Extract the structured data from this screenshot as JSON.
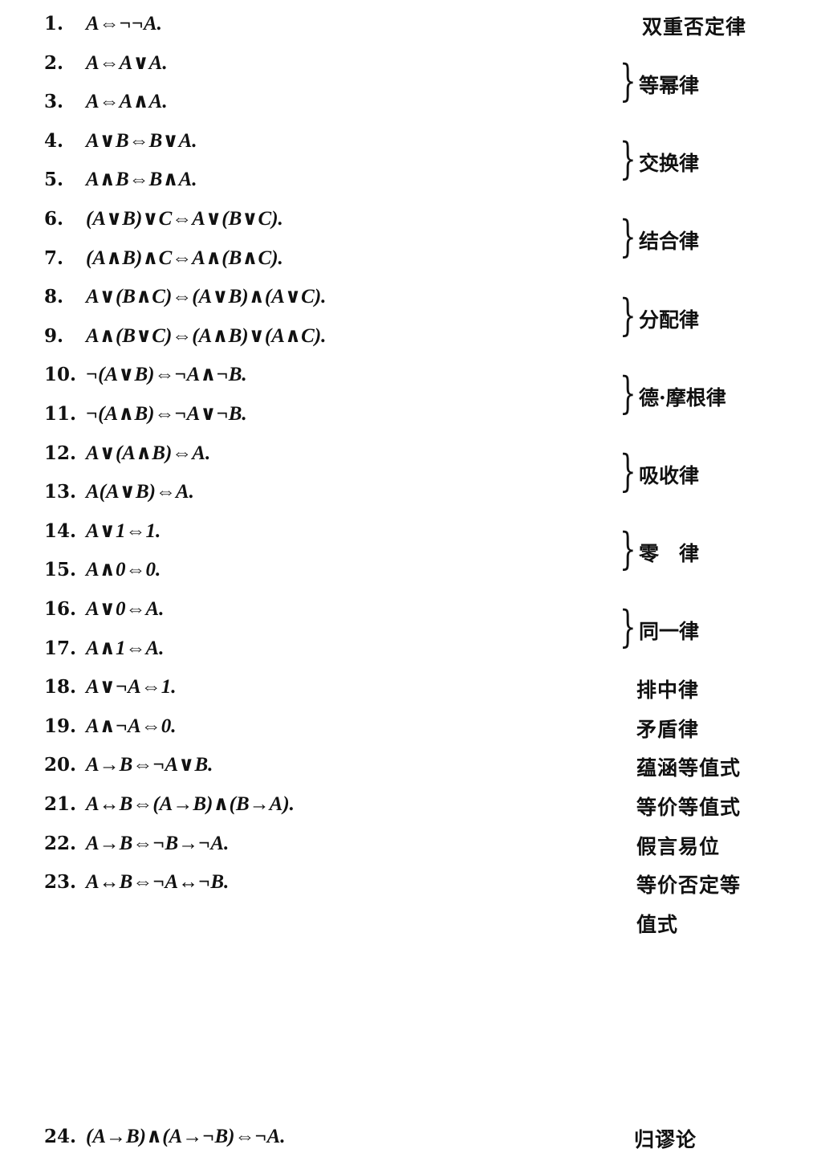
{
  "formulas": [
    {
      "n": "1.",
      "f": "A⇔¬¬A."
    },
    {
      "n": "2.",
      "f": "A⇔A∨A."
    },
    {
      "n": "3.",
      "f": "A⇔A∧A."
    },
    {
      "n": "4.",
      "f": "A∨B⇔B∨A."
    },
    {
      "n": "5.",
      "f": "A∧B⇔B∧A."
    },
    {
      "n": "6.",
      "f": "(A∨B)∨C⇔A∨(B∨C)."
    },
    {
      "n": "7.",
      "f": "(A∧B)∧C⇔A∧(B∧C)."
    },
    {
      "n": "8.",
      "f": "A∨(B∧C)⇔(A∨B)∧(A∨C)."
    },
    {
      "n": "9.",
      "f": "A∧(B∨C)⇔(A∧B)∨(A∧C)."
    },
    {
      "n": "10.",
      "f": "¬(A∨B)⇔¬A∧¬B."
    },
    {
      "n": "11.",
      "f": "¬(A∧B)⇔¬A∨¬B."
    },
    {
      "n": "12.",
      "f": "A∨(A∧B)⇔A."
    },
    {
      "n": "13.",
      "f": "A(A∨B)⇔A."
    },
    {
      "n": "14.",
      "f": "A∨1⇔1."
    },
    {
      "n": "15.",
      "f": "A∧0⇔0."
    },
    {
      "n": "16.",
      "f": "A∨0⇔A."
    },
    {
      "n": "17.",
      "f": "A∧1⇔A."
    },
    {
      "n": "18.",
      "f": "A∨¬A⇔1."
    },
    {
      "n": "19.",
      "f": "A∧¬A⇔0."
    },
    {
      "n": "20.",
      "f": "A→B⇔¬A∨B."
    },
    {
      "n": "21.",
      "f": "A↔B⇔(A→B)∧(B→A)."
    },
    {
      "n": "22.",
      "f": "A→B⇔¬B→¬A."
    },
    {
      "n": "23.",
      "f": "A↔B⇔¬A↔¬B."
    }
  ],
  "final_formula": {
    "n": "24.",
    "f": "(A→B)∧(A→¬B)⇔¬A."
  },
  "single_labels": [
    {
      "row": 1,
      "text": "双重否定律"
    },
    {
      "row": 18,
      "text": "排中律"
    },
    {
      "row": 19,
      "text": "矛盾律"
    },
    {
      "row": 20,
      "text": "蕴涵等值式"
    },
    {
      "row": 21,
      "text": "等价等值式"
    },
    {
      "row": 22,
      "text": "假言易位"
    },
    {
      "row": 23,
      "text": "等价否定等"
    },
    {
      "row": 24,
      "text": "值式"
    }
  ],
  "brace_labels": [
    {
      "rows": [
        2,
        3
      ],
      "text": "等幂律"
    },
    {
      "rows": [
        4,
        5
      ],
      "text": "交换律"
    },
    {
      "rows": [
        6,
        7
      ],
      "text": "结合律"
    },
    {
      "rows": [
        8,
        9
      ],
      "text": "分配律"
    },
    {
      "rows": [
        10,
        11
      ],
      "text": "德·摩根律"
    },
    {
      "rows": [
        12,
        13
      ],
      "text": "吸收律"
    },
    {
      "rows": [
        14,
        15
      ],
      "text": "零　律"
    },
    {
      "rows": [
        16,
        17
      ],
      "text": "同一律"
    }
  ],
  "final_label": "归谬论"
}
